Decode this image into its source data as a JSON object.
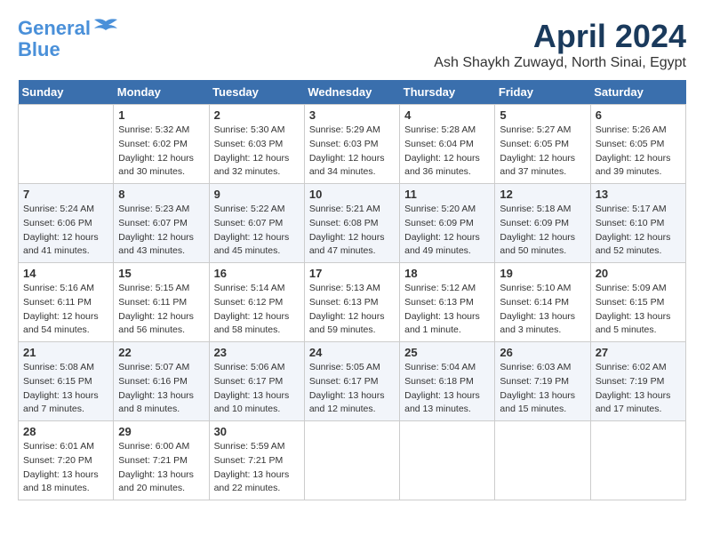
{
  "header": {
    "logo_line1": "General",
    "logo_line2": "Blue",
    "title": "April 2024",
    "subtitle": "Ash Shaykh Zuwayd, North Sinai, Egypt"
  },
  "columns": [
    "Sunday",
    "Monday",
    "Tuesday",
    "Wednesday",
    "Thursday",
    "Friday",
    "Saturday"
  ],
  "weeks": [
    [
      {
        "day": "",
        "info": ""
      },
      {
        "day": "1",
        "info": "Sunrise: 5:32 AM\nSunset: 6:02 PM\nDaylight: 12 hours\nand 30 minutes."
      },
      {
        "day": "2",
        "info": "Sunrise: 5:30 AM\nSunset: 6:03 PM\nDaylight: 12 hours\nand 32 minutes."
      },
      {
        "day": "3",
        "info": "Sunrise: 5:29 AM\nSunset: 6:03 PM\nDaylight: 12 hours\nand 34 minutes."
      },
      {
        "day": "4",
        "info": "Sunrise: 5:28 AM\nSunset: 6:04 PM\nDaylight: 12 hours\nand 36 minutes."
      },
      {
        "day": "5",
        "info": "Sunrise: 5:27 AM\nSunset: 6:05 PM\nDaylight: 12 hours\nand 37 minutes."
      },
      {
        "day": "6",
        "info": "Sunrise: 5:26 AM\nSunset: 6:05 PM\nDaylight: 12 hours\nand 39 minutes."
      }
    ],
    [
      {
        "day": "7",
        "info": "Sunrise: 5:24 AM\nSunset: 6:06 PM\nDaylight: 12 hours\nand 41 minutes."
      },
      {
        "day": "8",
        "info": "Sunrise: 5:23 AM\nSunset: 6:07 PM\nDaylight: 12 hours\nand 43 minutes."
      },
      {
        "day": "9",
        "info": "Sunrise: 5:22 AM\nSunset: 6:07 PM\nDaylight: 12 hours\nand 45 minutes."
      },
      {
        "day": "10",
        "info": "Sunrise: 5:21 AM\nSunset: 6:08 PM\nDaylight: 12 hours\nand 47 minutes."
      },
      {
        "day": "11",
        "info": "Sunrise: 5:20 AM\nSunset: 6:09 PM\nDaylight: 12 hours\nand 49 minutes."
      },
      {
        "day": "12",
        "info": "Sunrise: 5:18 AM\nSunset: 6:09 PM\nDaylight: 12 hours\nand 50 minutes."
      },
      {
        "day": "13",
        "info": "Sunrise: 5:17 AM\nSunset: 6:10 PM\nDaylight: 12 hours\nand 52 minutes."
      }
    ],
    [
      {
        "day": "14",
        "info": "Sunrise: 5:16 AM\nSunset: 6:11 PM\nDaylight: 12 hours\nand 54 minutes."
      },
      {
        "day": "15",
        "info": "Sunrise: 5:15 AM\nSunset: 6:11 PM\nDaylight: 12 hours\nand 56 minutes."
      },
      {
        "day": "16",
        "info": "Sunrise: 5:14 AM\nSunset: 6:12 PM\nDaylight: 12 hours\nand 58 minutes."
      },
      {
        "day": "17",
        "info": "Sunrise: 5:13 AM\nSunset: 6:13 PM\nDaylight: 12 hours\nand 59 minutes."
      },
      {
        "day": "18",
        "info": "Sunrise: 5:12 AM\nSunset: 6:13 PM\nDaylight: 13 hours\nand 1 minute."
      },
      {
        "day": "19",
        "info": "Sunrise: 5:10 AM\nSunset: 6:14 PM\nDaylight: 13 hours\nand 3 minutes."
      },
      {
        "day": "20",
        "info": "Sunrise: 5:09 AM\nSunset: 6:15 PM\nDaylight: 13 hours\nand 5 minutes."
      }
    ],
    [
      {
        "day": "21",
        "info": "Sunrise: 5:08 AM\nSunset: 6:15 PM\nDaylight: 13 hours\nand 7 minutes."
      },
      {
        "day": "22",
        "info": "Sunrise: 5:07 AM\nSunset: 6:16 PM\nDaylight: 13 hours\nand 8 minutes."
      },
      {
        "day": "23",
        "info": "Sunrise: 5:06 AM\nSunset: 6:17 PM\nDaylight: 13 hours\nand 10 minutes."
      },
      {
        "day": "24",
        "info": "Sunrise: 5:05 AM\nSunset: 6:17 PM\nDaylight: 13 hours\nand 12 minutes."
      },
      {
        "day": "25",
        "info": "Sunrise: 5:04 AM\nSunset: 6:18 PM\nDaylight: 13 hours\nand 13 minutes."
      },
      {
        "day": "26",
        "info": "Sunrise: 6:03 AM\nSunset: 7:19 PM\nDaylight: 13 hours\nand 15 minutes."
      },
      {
        "day": "27",
        "info": "Sunrise: 6:02 AM\nSunset: 7:19 PM\nDaylight: 13 hours\nand 17 minutes."
      }
    ],
    [
      {
        "day": "28",
        "info": "Sunrise: 6:01 AM\nSunset: 7:20 PM\nDaylight: 13 hours\nand 18 minutes."
      },
      {
        "day": "29",
        "info": "Sunrise: 6:00 AM\nSunset: 7:21 PM\nDaylight: 13 hours\nand 20 minutes."
      },
      {
        "day": "30",
        "info": "Sunrise: 5:59 AM\nSunset: 7:21 PM\nDaylight: 13 hours\nand 22 minutes."
      },
      {
        "day": "",
        "info": ""
      },
      {
        "day": "",
        "info": ""
      },
      {
        "day": "",
        "info": ""
      },
      {
        "day": "",
        "info": ""
      }
    ]
  ]
}
